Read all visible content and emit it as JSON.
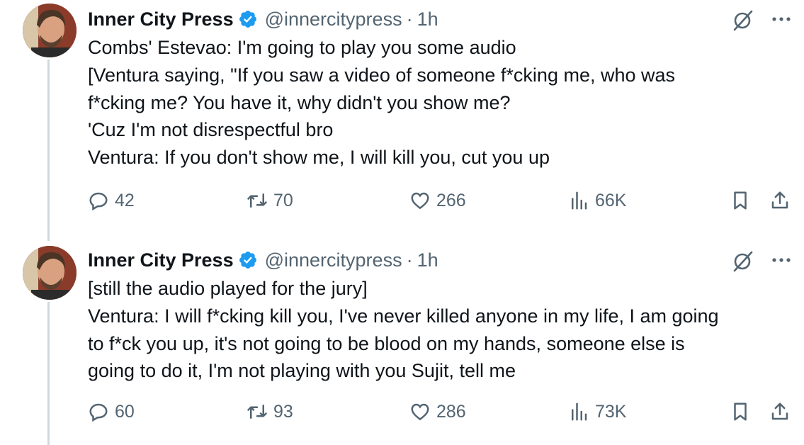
{
  "tweets": [
    {
      "author_name": "Inner City Press",
      "handle": "@innercitypress",
      "separator": "·",
      "time": "1h",
      "lines": [
        "Combs' Estevao: I'm going to play you some audio",
        "[Ventura saying, \"If you saw a video of someone f*cking me, who was",
        "f*cking me? You have it, why didn't you show me?",
        "'Cuz I'm not disrespectful bro",
        "Ventura: If you don't show me, I will kill you, cut you up"
      ],
      "replies": "42",
      "reposts": "70",
      "likes": "266",
      "views": "66K"
    },
    {
      "author_name": "Inner City Press",
      "handle": "@innercitypress",
      "separator": "·",
      "time": "1h",
      "lines": [
        "[still the audio played for the jury]",
        "Ventura: I will f*cking kill you, I've never killed anyone in my life, I am going",
        "to f*ck you up, it's not going to be blood on my hands, someone else is",
        "going to do it, I'm not playing with you Sujit, tell me"
      ],
      "replies": "60",
      "reposts": "93",
      "likes": "286",
      "views": "73K"
    }
  ],
  "colors": {
    "verified_blue": "#1d9bf0",
    "secondary_text": "#536471",
    "primary_text": "#0f1419",
    "thread_line": "#cfd9de"
  },
  "icons": [
    "verified-badge-icon",
    "grok-icon",
    "more-icon",
    "reply-icon",
    "repost-icon",
    "like-icon",
    "views-icon",
    "bookmark-icon",
    "share-icon"
  ]
}
